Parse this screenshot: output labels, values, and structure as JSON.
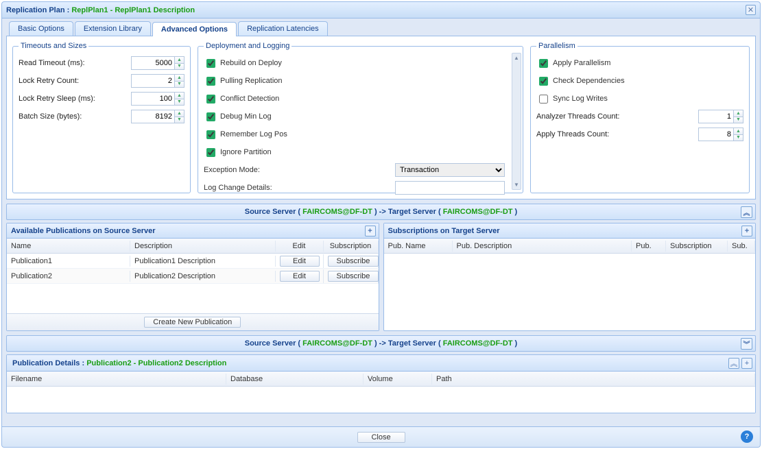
{
  "window": {
    "title_prefix": "Replication Plan : ",
    "plan_name": "ReplPlan1",
    "plan_desc_sep": " - ",
    "plan_desc": "ReplPlan1 Description"
  },
  "tabs": {
    "basic": "Basic Options",
    "ext": "Extension Library",
    "adv": "Advanced Options",
    "lat": "Replication Latencies"
  },
  "timeouts": {
    "legend": "Timeouts and Sizes",
    "read_label": "Read Timeout (ms):",
    "read_val": "5000",
    "retry_label": "Lock Retry Count:",
    "retry_val": "2",
    "sleep_label": "Lock Retry Sleep (ms):",
    "sleep_val": "100",
    "batch_label": "Batch Size (bytes):",
    "batch_val": "8192"
  },
  "deploy": {
    "legend": "Deployment and Logging",
    "rebuild": "Rebuild on Deploy",
    "pulling": "Pulling Replication",
    "conflict": "Conflict Detection",
    "debug": "Debug Min Log",
    "remember": "Remember Log Pos",
    "ignore": "Ignore Partition",
    "exc_label": "Exception Mode:",
    "exc_val": "Transaction",
    "log_label": "Log Change Details:",
    "log_val": ""
  },
  "para": {
    "legend": "Parallelism",
    "apply": "Apply Parallelism",
    "check": "Check Dependencies",
    "sync": "Sync Log Writes",
    "an_label": "Analyzer Threads Count:",
    "an_val": "1",
    "ap_label": "Apply Threads Count:",
    "ap_val": "8"
  },
  "servers": {
    "src_lbl": "Source Server ( ",
    "src_name": "FAIRCOMS@DF-DT",
    "arrow": " ) -> Target Server ( ",
    "tgt_name": "FAIRCOMS@DF-DT",
    "end": " )"
  },
  "pubs": {
    "panel_title": "Available Publications on Source Server",
    "col_name": "Name",
    "col_desc": "Description",
    "col_edit": "Edit",
    "col_sub": "Subscription",
    "rows": [
      {
        "name": "Publication1",
        "desc": "Publication1 Description"
      },
      {
        "name": "Publication2",
        "desc": "Publication2 Description"
      }
    ],
    "edit_btn": "Edit",
    "sub_btn": "Subscribe",
    "create_btn": "Create New Publication"
  },
  "subs": {
    "panel_title": "Subscriptions on Target Server",
    "c1": "Pub. Name",
    "c2": "Pub. Description",
    "c3": "Pub.",
    "c4": "Subscription",
    "c5": "Sub."
  },
  "detail": {
    "prefix": "Publication Details : ",
    "name": "Publication2",
    "sep": " - ",
    "desc": "Publication2 Description",
    "c1": "Filename",
    "c2": "Database",
    "c3": "Volume",
    "c4": "Path"
  },
  "close_btn": "Close"
}
